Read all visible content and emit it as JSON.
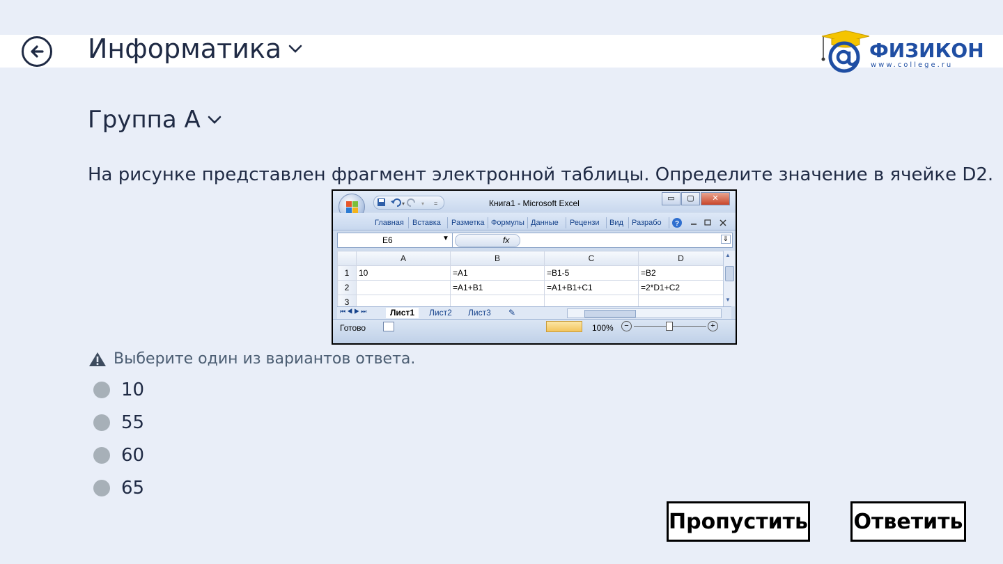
{
  "header": {
    "title": "Информатика",
    "logo": {
      "brand": "ФИЗИКОН",
      "url": "www.college.ru"
    }
  },
  "group": {
    "title": "Группа А"
  },
  "question": {
    "text": "На рисунке представлен фрагмент электронной таблицы. Определите значение в ячейке D2."
  },
  "excel": {
    "window_title": "Книга1 - Microsoft Excel",
    "ribbon_tabs": [
      "Главная",
      "Вставка",
      "Разметка",
      "Формулы",
      "Данные",
      "Рецензи",
      "Вид",
      "Разрабо"
    ],
    "name_box": "E6",
    "fx": "fx",
    "column_headers": [
      "A",
      "B",
      "C",
      "D"
    ],
    "rows": [
      {
        "num": "1",
        "cells": [
          "10",
          "=A1",
          "=B1-5",
          "=B2"
        ]
      },
      {
        "num": "2",
        "cells": [
          "",
          "=A1+B1",
          "=A1+B1+C1",
          "=2*D1+C2"
        ]
      },
      {
        "num": "3",
        "cells": [
          "",
          "",
          "",
          ""
        ]
      }
    ],
    "sheets": [
      "Лист1",
      "Лист2",
      "Лист3"
    ],
    "status": "Готово",
    "zoom": "100%"
  },
  "hint": "Выберите один из вариантов ответа.",
  "options": [
    "10",
    "55",
    "60",
    "65"
  ],
  "buttons": {
    "skip": "Пропустить",
    "answer": "Ответить"
  }
}
